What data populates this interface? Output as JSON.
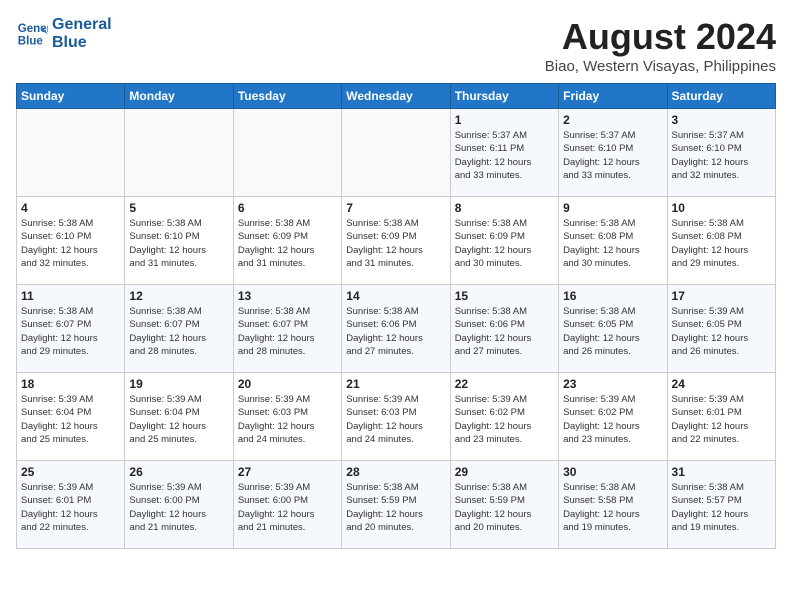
{
  "header": {
    "logo_line1": "General",
    "logo_line2": "Blue",
    "month_title": "August 2024",
    "subtitle": "Biao, Western Visayas, Philippines"
  },
  "weekdays": [
    "Sunday",
    "Monday",
    "Tuesday",
    "Wednesday",
    "Thursday",
    "Friday",
    "Saturday"
  ],
  "weeks": [
    [
      {
        "day": "",
        "info": ""
      },
      {
        "day": "",
        "info": ""
      },
      {
        "day": "",
        "info": ""
      },
      {
        "day": "",
        "info": ""
      },
      {
        "day": "1",
        "info": "Sunrise: 5:37 AM\nSunset: 6:11 PM\nDaylight: 12 hours\nand 33 minutes."
      },
      {
        "day": "2",
        "info": "Sunrise: 5:37 AM\nSunset: 6:10 PM\nDaylight: 12 hours\nand 33 minutes."
      },
      {
        "day": "3",
        "info": "Sunrise: 5:37 AM\nSunset: 6:10 PM\nDaylight: 12 hours\nand 32 minutes."
      }
    ],
    [
      {
        "day": "4",
        "info": "Sunrise: 5:38 AM\nSunset: 6:10 PM\nDaylight: 12 hours\nand 32 minutes."
      },
      {
        "day": "5",
        "info": "Sunrise: 5:38 AM\nSunset: 6:10 PM\nDaylight: 12 hours\nand 31 minutes."
      },
      {
        "day": "6",
        "info": "Sunrise: 5:38 AM\nSunset: 6:09 PM\nDaylight: 12 hours\nand 31 minutes."
      },
      {
        "day": "7",
        "info": "Sunrise: 5:38 AM\nSunset: 6:09 PM\nDaylight: 12 hours\nand 31 minutes."
      },
      {
        "day": "8",
        "info": "Sunrise: 5:38 AM\nSunset: 6:09 PM\nDaylight: 12 hours\nand 30 minutes."
      },
      {
        "day": "9",
        "info": "Sunrise: 5:38 AM\nSunset: 6:08 PM\nDaylight: 12 hours\nand 30 minutes."
      },
      {
        "day": "10",
        "info": "Sunrise: 5:38 AM\nSunset: 6:08 PM\nDaylight: 12 hours\nand 29 minutes."
      }
    ],
    [
      {
        "day": "11",
        "info": "Sunrise: 5:38 AM\nSunset: 6:07 PM\nDaylight: 12 hours\nand 29 minutes."
      },
      {
        "day": "12",
        "info": "Sunrise: 5:38 AM\nSunset: 6:07 PM\nDaylight: 12 hours\nand 28 minutes."
      },
      {
        "day": "13",
        "info": "Sunrise: 5:38 AM\nSunset: 6:07 PM\nDaylight: 12 hours\nand 28 minutes."
      },
      {
        "day": "14",
        "info": "Sunrise: 5:38 AM\nSunset: 6:06 PM\nDaylight: 12 hours\nand 27 minutes."
      },
      {
        "day": "15",
        "info": "Sunrise: 5:38 AM\nSunset: 6:06 PM\nDaylight: 12 hours\nand 27 minutes."
      },
      {
        "day": "16",
        "info": "Sunrise: 5:38 AM\nSunset: 6:05 PM\nDaylight: 12 hours\nand 26 minutes."
      },
      {
        "day": "17",
        "info": "Sunrise: 5:39 AM\nSunset: 6:05 PM\nDaylight: 12 hours\nand 26 minutes."
      }
    ],
    [
      {
        "day": "18",
        "info": "Sunrise: 5:39 AM\nSunset: 6:04 PM\nDaylight: 12 hours\nand 25 minutes."
      },
      {
        "day": "19",
        "info": "Sunrise: 5:39 AM\nSunset: 6:04 PM\nDaylight: 12 hours\nand 25 minutes."
      },
      {
        "day": "20",
        "info": "Sunrise: 5:39 AM\nSunset: 6:03 PM\nDaylight: 12 hours\nand 24 minutes."
      },
      {
        "day": "21",
        "info": "Sunrise: 5:39 AM\nSunset: 6:03 PM\nDaylight: 12 hours\nand 24 minutes."
      },
      {
        "day": "22",
        "info": "Sunrise: 5:39 AM\nSunset: 6:02 PM\nDaylight: 12 hours\nand 23 minutes."
      },
      {
        "day": "23",
        "info": "Sunrise: 5:39 AM\nSunset: 6:02 PM\nDaylight: 12 hours\nand 23 minutes."
      },
      {
        "day": "24",
        "info": "Sunrise: 5:39 AM\nSunset: 6:01 PM\nDaylight: 12 hours\nand 22 minutes."
      }
    ],
    [
      {
        "day": "25",
        "info": "Sunrise: 5:39 AM\nSunset: 6:01 PM\nDaylight: 12 hours\nand 22 minutes."
      },
      {
        "day": "26",
        "info": "Sunrise: 5:39 AM\nSunset: 6:00 PM\nDaylight: 12 hours\nand 21 minutes."
      },
      {
        "day": "27",
        "info": "Sunrise: 5:39 AM\nSunset: 6:00 PM\nDaylight: 12 hours\nand 21 minutes."
      },
      {
        "day": "28",
        "info": "Sunrise: 5:38 AM\nSunset: 5:59 PM\nDaylight: 12 hours\nand 20 minutes."
      },
      {
        "day": "29",
        "info": "Sunrise: 5:38 AM\nSunset: 5:59 PM\nDaylight: 12 hours\nand 20 minutes."
      },
      {
        "day": "30",
        "info": "Sunrise: 5:38 AM\nSunset: 5:58 PM\nDaylight: 12 hours\nand 19 minutes."
      },
      {
        "day": "31",
        "info": "Sunrise: 5:38 AM\nSunset: 5:57 PM\nDaylight: 12 hours\nand 19 minutes."
      }
    ]
  ]
}
